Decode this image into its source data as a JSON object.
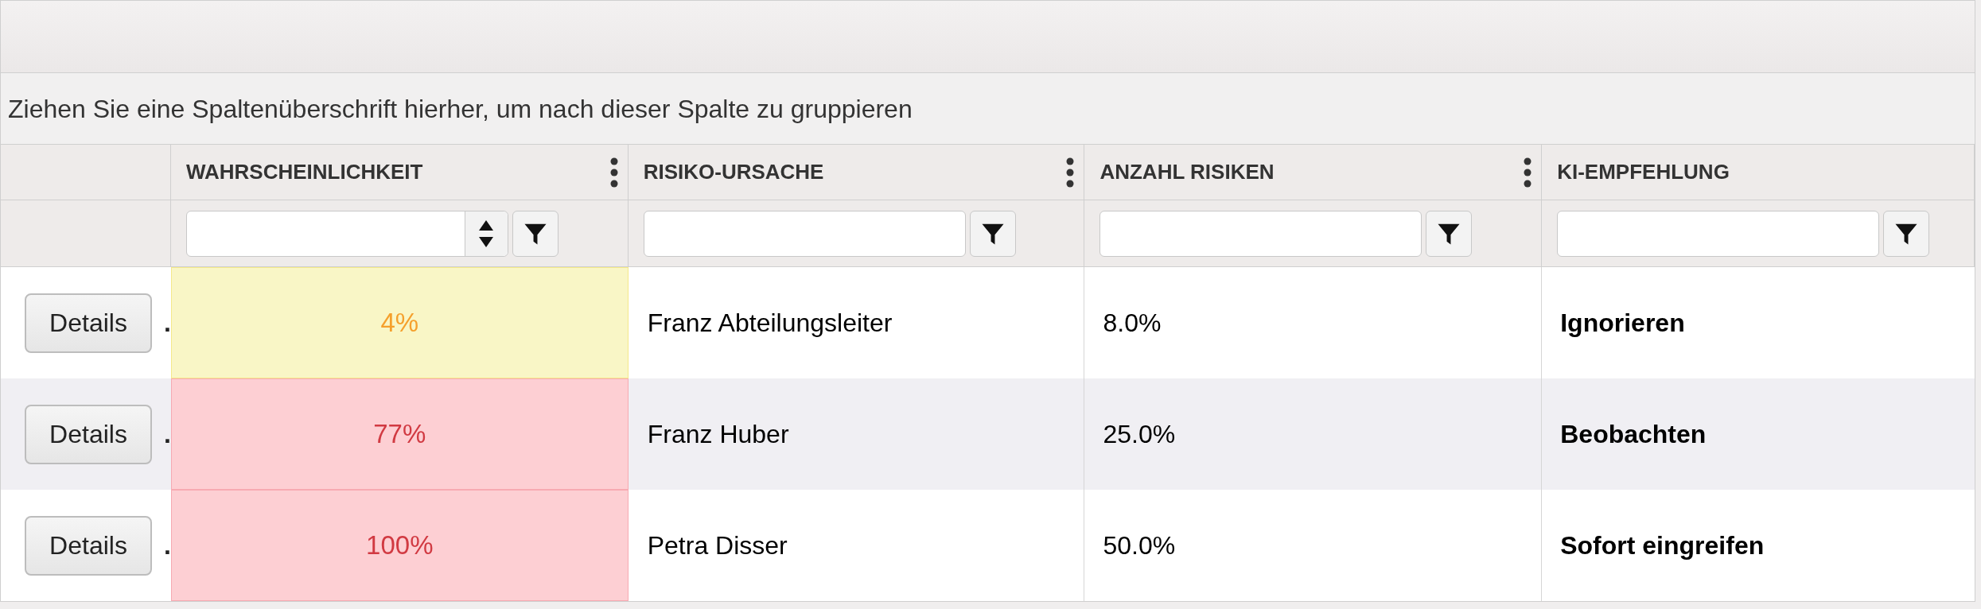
{
  "group_panel": {
    "hint": "Ziehen Sie eine Spaltenüberschrift hierher, um nach dieser Spalte zu gruppieren"
  },
  "table": {
    "columns": [
      {
        "label": "WAHRSCHEINLICHKEIT",
        "menu": true,
        "kind": "numeric"
      },
      {
        "label": "RISIKO-URSACHE",
        "menu": true,
        "kind": "text"
      },
      {
        "label": "ANZAHL RISIKEN",
        "menu": true,
        "kind": "text"
      },
      {
        "label": "KI-EMPFEHLUNG",
        "menu": false,
        "kind": "text"
      }
    ],
    "rows": [
      {
        "button": "Details",
        "marker": ".",
        "probability": "4%",
        "kind": "warning",
        "cause": "Franz Abteilungsleiter",
        "count": "8.0%",
        "recommendation": "Ignorieren"
      },
      {
        "button": "Details",
        "marker": ".",
        "probability": "77%",
        "kind": "critical",
        "cause": "Franz Huber",
        "count": "25.0%",
        "recommendation": "Beobachten"
      },
      {
        "button": "Details",
        "marker": ".",
        "probability": "100%",
        "kind": "critical",
        "cause": "Petra Disser",
        "count": "50.0%",
        "recommendation": "Sofort eingreifen"
      }
    ]
  }
}
